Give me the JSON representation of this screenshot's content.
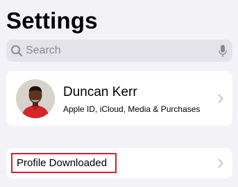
{
  "header": {
    "title": "Settings"
  },
  "search": {
    "placeholder": "Search",
    "icon": "search-icon",
    "mic_icon": "microphone-icon"
  },
  "account": {
    "name": "Duncan Kerr",
    "subtitle": "Apple ID, iCloud, Media & Purchases",
    "avatar": "user-avatar-photo",
    "chevron": "chevron-right-icon"
  },
  "profile_downloaded": {
    "label": "Profile Downloaded",
    "chevron": "chevron-right-icon",
    "highlight_color": "#e0192b"
  },
  "colors": {
    "background": "#f2f2f7",
    "card": "#ffffff",
    "search_field": "#e3e3e9",
    "secondary_text": "#8a8a8e",
    "chevron": "#c4c4c7"
  }
}
